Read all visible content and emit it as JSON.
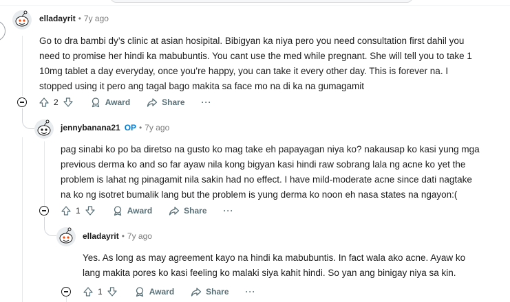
{
  "comments": [
    {
      "author": "elladayrit",
      "op_badge": "",
      "separator": "•",
      "age": "7y ago",
      "lines": [
        "Go to dra bambi dy’s clinic at asian hosipital. Bibigyan ka niya pero you need consultation first dahil you",
        "need to promise her hindi ka mabubuntis. You cant use the med while pregnant. She will tell you to take 1",
        "10mg tablet a day everyday, once you’re happy, you can take it every other day. This is forever na. I",
        "stopped using it pero ang tagal bago makita sa face mo na di ka na gumagamit"
      ],
      "score": "2",
      "award_label": "Award",
      "share_label": "Share",
      "more_label": "···"
    },
    {
      "author": "jennybanana21",
      "op_badge": "OP",
      "separator": "•",
      "age": "7y ago",
      "lines": [
        "pag sinabi ko po ba diretso na gusto ko mag take eh papayagan niya ko? nakausap ko kasi yung mga",
        "previous derma ko and so far ayaw nila kong bigyan kasi hindi raw sobrang lala ng acne ko yet the",
        "problem is lahat ng pinagamit nila sakin had no effect. I have mild-moderate acne since dati nagtake",
        "na ko ng isotret bumalik lang but the problem is yung derma ko noon eh nasa states na ngayon:("
      ],
      "score": "1",
      "award_label": "Award",
      "share_label": "Share",
      "more_label": "···"
    },
    {
      "author": "elladayrit",
      "op_badge": "",
      "separator": "•",
      "age": "7y ago",
      "lines": [
        "Yes. As long as may agreement kayo na hindi ka mabubuntis. In fact wala ako acne. Ayaw ko",
        "lang makita pores ko kasi feeling ko malaki siya kahit hindi. So yan ang binigay niya sa kin."
      ],
      "score": "1",
      "award_label": "Award",
      "share_label": "Share",
      "more_label": "···"
    }
  ],
  "colors": {
    "accent_op": "#0079d3",
    "meta_gray": "#7c7c7c",
    "action_gray": "#576f76",
    "thread_line": "#d2d6d9"
  },
  "icons": [
    "snoo-avatar-icon",
    "upvote-arrow-icon",
    "downvote-arrow-icon",
    "award-icon",
    "share-icon",
    "collapse-minus-icon",
    "more-icon"
  ]
}
